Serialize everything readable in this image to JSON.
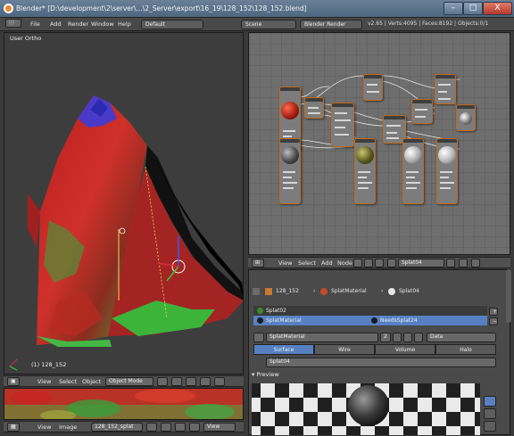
{
  "window": {
    "title": "Blender* [D:\\development\\2\\server\\...\\2_Server\\export\\16_19\\128_152\\128_152.blend]",
    "minimize": "–",
    "maximize": "□",
    "close": "X"
  },
  "menu": {
    "items": [
      "File",
      "Add",
      "Render",
      "Window",
      "Help"
    ],
    "layout": "Default",
    "scene": "Scene",
    "engine": "Blender Render",
    "stats": "v2.65 | Verts:4095 | Faces:8192 | Objects:0/1"
  },
  "viewport": {
    "label": "User Ortho",
    "object_name": "(1) 128_152",
    "header": {
      "view": "View",
      "select": "Select",
      "object": "Object",
      "mode": "Object Mode"
    }
  },
  "uv_editor": {
    "header": {
      "view": "View",
      "image": "Image",
      "image_name": "128_152_splat",
      "view2": "View"
    }
  },
  "node_editor": {
    "header": {
      "view": "View",
      "select": "Select",
      "add": "Add",
      "node": "Node",
      "material": "Splat04"
    }
  },
  "properties": {
    "breadcrumb": [
      "128_152",
      "SplatMaterial",
      "Splat04"
    ],
    "slots": [
      {
        "name": "Splat02",
        "color": "#3d8a2a"
      },
      {
        "name": "SplatMaterial",
        "color": "#1a1a1a"
      }
    ],
    "slot_extra": "NeedsSplat24",
    "material_field": "SplatMaterial",
    "material_users": "2",
    "data_dropdown": "Data",
    "tabs": [
      "Surface",
      "Wire",
      "Volume",
      "Halo"
    ],
    "active_tab": "Surface",
    "node_field": "Splat04",
    "preview_label": "Preview"
  },
  "colors": {
    "selected": "#5680c2",
    "node_border": "#c26a1c",
    "terrain_red": "#c82828",
    "terrain_green": "#3caa3c"
  }
}
